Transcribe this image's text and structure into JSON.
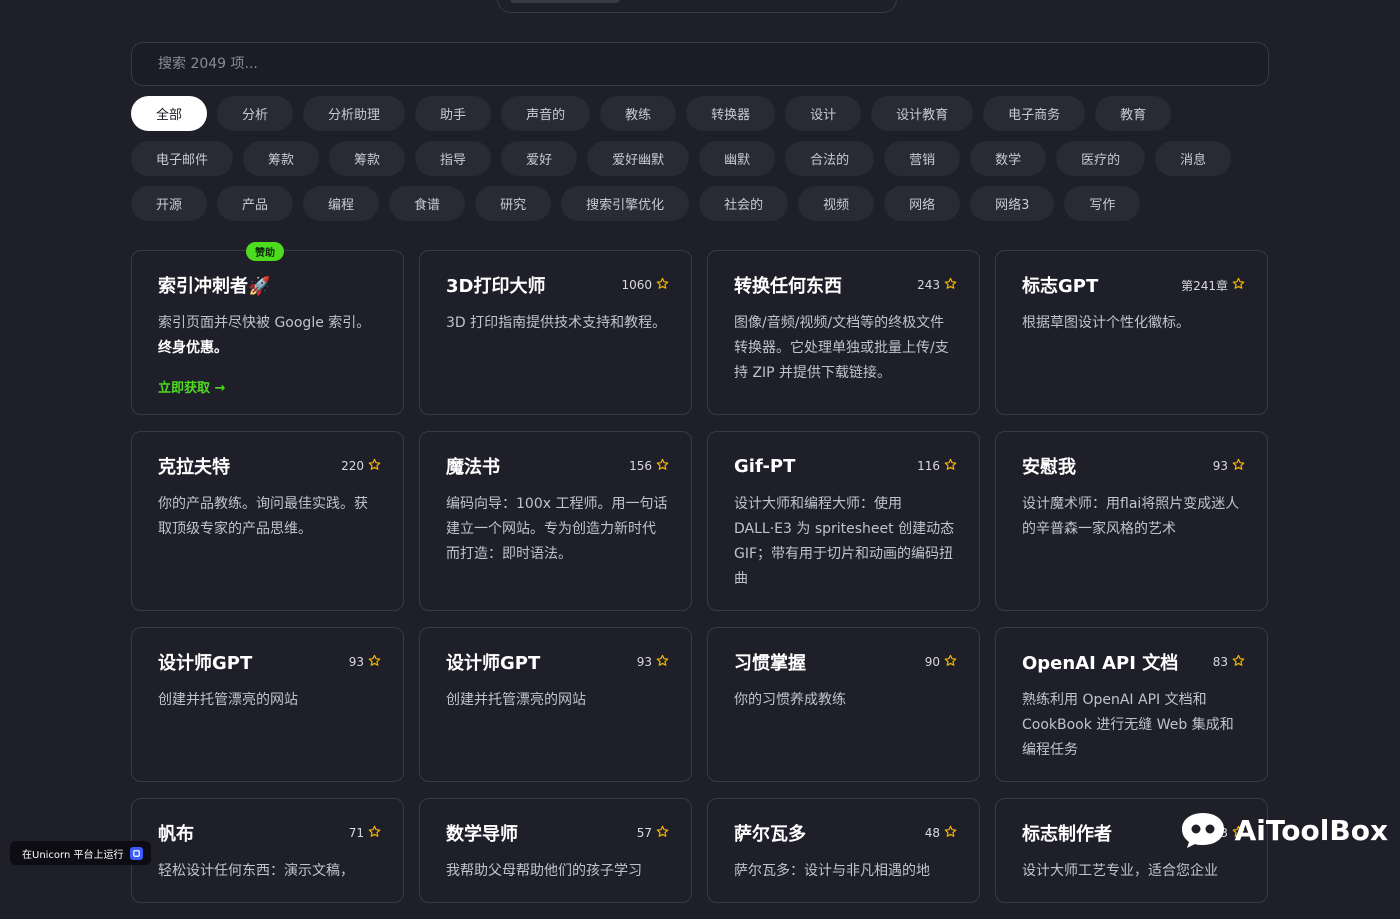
{
  "search": {
    "placeholder": "搜索 2049 项..."
  },
  "filters": [
    "全部",
    "分析",
    "分析助理",
    "助手",
    "声音的",
    "教练",
    "转换器",
    "设计",
    "设计教育",
    "电子商务",
    "教育",
    "电子邮件",
    "筹款",
    "筹款",
    "指导",
    "爱好",
    "爱好幽默",
    "幽默",
    "合法的",
    "营销",
    "数学",
    "医疗的",
    "消息",
    "开源",
    "产品",
    "编程",
    "食谱",
    "研究",
    "搜索引擎优化",
    "社会的",
    "视频",
    "网络",
    "网络3",
    "写作"
  ],
  "active_filter": "全部",
  "sponsored": {
    "badge": "赞助",
    "title": "索引冲刺者🚀",
    "desc_plain": "索引页面并尽快被 Google 索引。",
    "desc_bold": "终身优惠。",
    "cta": "立即获取 →"
  },
  "cards": [
    {
      "title": "3D打印大师",
      "stars": "1060",
      "desc": "3D 打印指南提供技术支持和教程。"
    },
    {
      "title": "转换任何东西",
      "stars": "243",
      "desc": "图像/音频/视频/文档等的终极文件转换器。它处理单独或批量上传/支持 ZIP 并提供下载链接。"
    },
    {
      "title": "标志GPT",
      "stars": "第241章",
      "desc": "根据草图设计个性化徽标。"
    },
    {
      "title": "克拉夫特",
      "stars": "220",
      "desc": "你的产品教练。询问最佳实践。获取顶级专家的产品思维。"
    },
    {
      "title": "魔法书",
      "stars": "156",
      "desc": "编码向导：100x 工程师。用一句话建立一个网站。专为创造力新时代而打造：即时语法。"
    },
    {
      "title": "Gif-PT",
      "stars": "116",
      "desc": "设计大师和编程大师：使用 DALL·E3 为 spritesheet 创建动态 GIF；带有用于切片和动画的编码扭曲"
    },
    {
      "title": "安慰我",
      "stars": "93",
      "desc": "设计魔术师：用flai将照片变成迷人的辛普森一家风格的艺术"
    },
    {
      "title": "设计师GPT",
      "stars": "93",
      "desc": "创建并托管漂亮的网站"
    },
    {
      "title": "设计师GPT",
      "stars": "93",
      "desc": "创建并托管漂亮的网站"
    },
    {
      "title": "习惯掌握",
      "stars": "90",
      "desc": "你的习惯养成教练"
    },
    {
      "title": "OpenAI API 文档",
      "stars": "83",
      "desc": "熟练利用 OpenAI API 文档和 CookBook 进行无缝 Web 集成和编程任务"
    },
    {
      "title": "帆布",
      "stars": "71",
      "desc": "轻松设计任何东西：演示文稿，"
    },
    {
      "title": "数学导师",
      "stars": "57",
      "desc": "我帮助父母帮助他们的孩子学习"
    },
    {
      "title": "萨尔瓦多",
      "stars": "48",
      "desc": "萨尔瓦多：设计与非凡相遇的地"
    },
    {
      "title": "标志制作者",
      "stars": "43",
      "desc": "设计大师工艺专业，适合您企业"
    }
  ],
  "footer": {
    "unicorn": "在Unicorn 平台上运行",
    "watermark": "AiToolBox"
  },
  "colors": {
    "accent": "#4ddb1f",
    "star": "#f5b400",
    "background": "#1f1f29"
  }
}
